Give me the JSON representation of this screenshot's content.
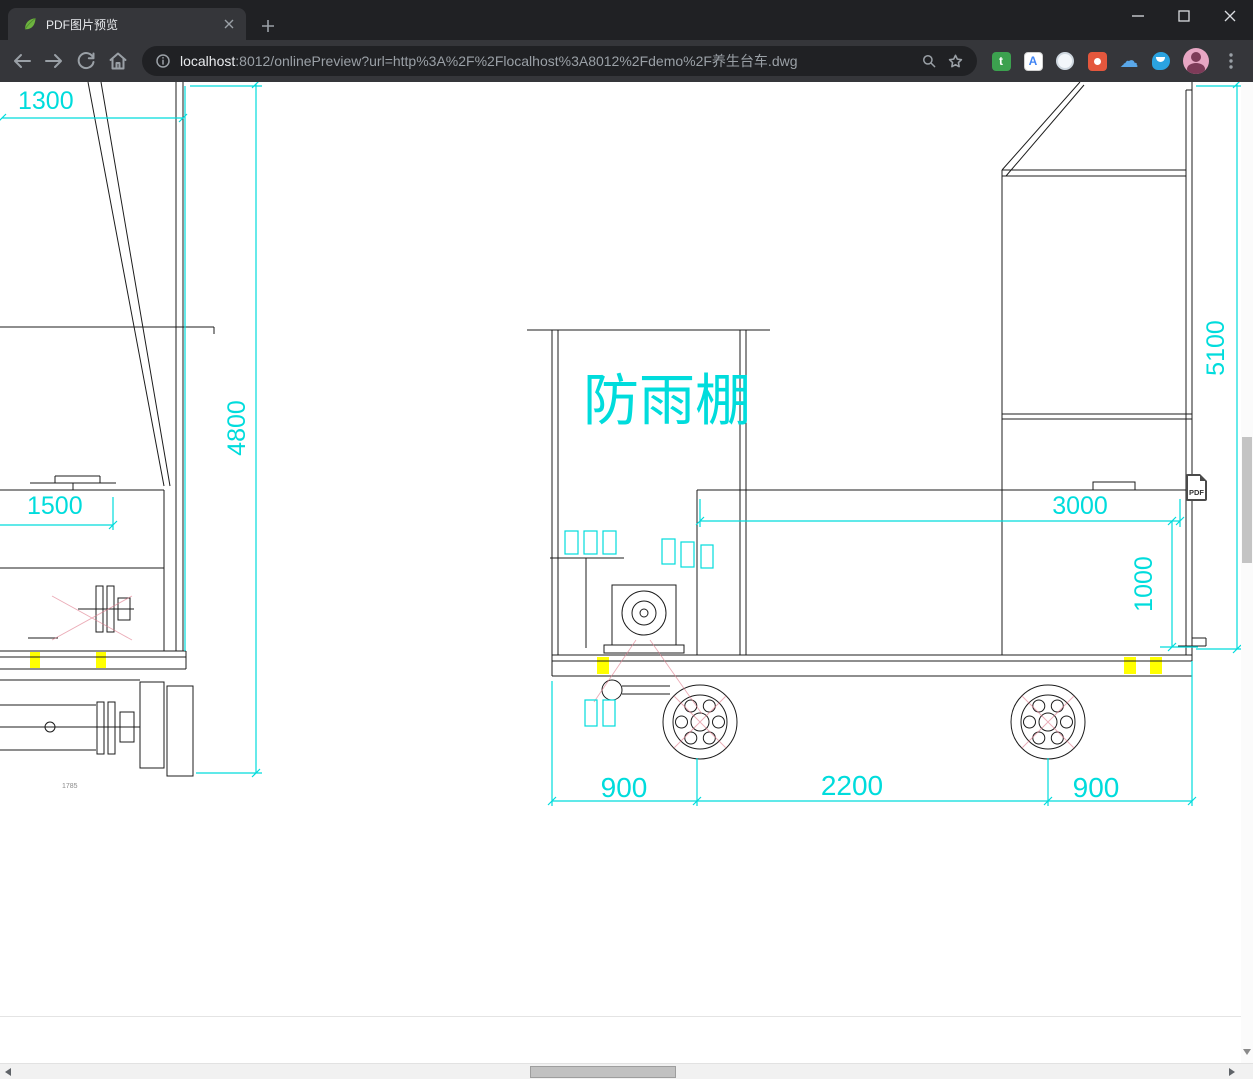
{
  "browser": {
    "tab_title": "PDF图片预览",
    "url_host": "localhost",
    "url_path": ":8012/onlinePreview?url=http%3A%2F%2Flocalhost%3A8012%2Fdemo%2F养生台车.dwg"
  },
  "drawing": {
    "shelter_label": "防雨棚",
    "pdf_icon_label": "PDF",
    "dimensions": {
      "top_width": "1300",
      "mast_height": "4800",
      "body_width": "1500",
      "frame_height": "5100",
      "deck_length": "3000",
      "deck_height": "1000",
      "rear_overhang": "900",
      "wheelbase": "2200",
      "front_overhang": "900",
      "detail_note": "1785"
    },
    "colors": {
      "dimension": "#00dcdc",
      "geometry": "#1c1c1c",
      "highlight": "#ffff00",
      "construction": "#e08090"
    }
  },
  "icons": {
    "ext_translate_letter": "t",
    "ext_gtranslate_letter": "A",
    "ext_cloud": "☁"
  }
}
